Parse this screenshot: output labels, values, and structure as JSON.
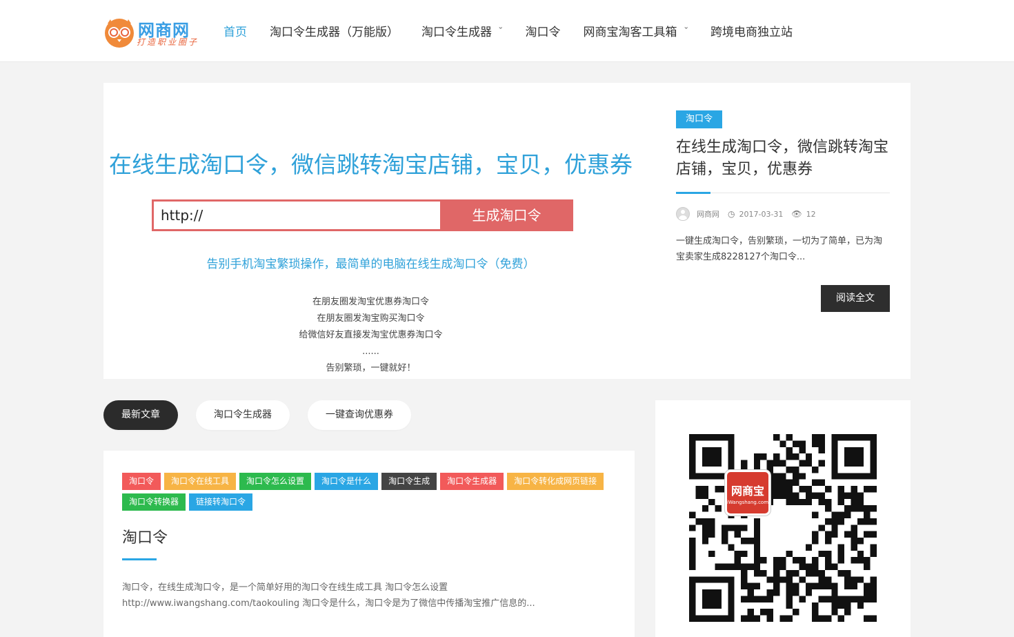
{
  "colors": {
    "accent": "#2fa1d9",
    "generate_btn": "#e06767",
    "dark": "#2b2b2b"
  },
  "header": {
    "logo": {
      "name": "网商网",
      "slogan": "打造职业圈子",
      "icon": "owl-icon"
    },
    "nav": [
      {
        "label": "首页",
        "active": true,
        "dropdown": false
      },
      {
        "label": "淘口令生成器（万能版）",
        "active": false,
        "dropdown": false
      },
      {
        "label": "淘口令生成器",
        "active": false,
        "dropdown": true
      },
      {
        "label": "淘口令",
        "active": false,
        "dropdown": false
      },
      {
        "label": "网商宝淘客工具箱",
        "active": false,
        "dropdown": true
      },
      {
        "label": "跨境电商独立站",
        "active": false,
        "dropdown": false
      }
    ]
  },
  "hero": {
    "title": "在线生成淘口令，微信跳转淘宝店铺，宝贝，优惠券",
    "input_value": "http://",
    "generate_label": "生成淘口令",
    "subtitle": "告别手机淘宝繁琐操作，最简单的电脑在线生成淘口令（免费）",
    "lines": [
      "在朋友圈发淘宝优惠券淘口令",
      "在朋友圈发淘宝购买淘口令",
      "给微信好友直接发淘宝优惠券淘口令",
      "......",
      "告别繁琐，一键就好！"
    ]
  },
  "featured": {
    "tag": "淘口令",
    "title": "在线生成淘口令，微信跳转淘宝店铺，宝贝，优惠券",
    "author": "网商网",
    "date": "2017-03-31",
    "views": "12",
    "excerpt": "一键生成淘口令，告别繁琐，一切为了简单，已为淘宝卖家生成8228127个淘口令...",
    "read_label": "阅读全文"
  },
  "tabs": [
    {
      "label": "最新文章",
      "active": true
    },
    {
      "label": "淘口令生成器",
      "active": false
    },
    {
      "label": "一键查询优惠券",
      "active": false
    }
  ],
  "article": {
    "tags": [
      {
        "label": "淘口令",
        "color": "#f25a5a"
      },
      {
        "label": "淘口令在线工具",
        "color": "#f7b445"
      },
      {
        "label": "淘口令怎么设置",
        "color": "#2dba4e"
      },
      {
        "label": "淘口令是什么",
        "color": "#2aa6e4"
      },
      {
        "label": "淘口令生成",
        "color": "#444444"
      },
      {
        "label": "淘口令生成器",
        "color": "#f25a5a"
      },
      {
        "label": "淘口令转化成网页链接",
        "color": "#f7b445"
      },
      {
        "label": "淘口令转换器",
        "color": "#2dba4e"
      },
      {
        "label": "链接转淘口令",
        "color": "#2aa6e4"
      }
    ],
    "title": "淘口令",
    "excerpt": "淘口令，在线生成淘口令，是一个简单好用的淘口令在线生成工具 淘口令怎么设置 http://www.iwangshang.com/taokouling 淘口令是什么，淘口令是为了微信中传播淘宝推广信息的..."
  },
  "sidebar": {
    "qr_badge_name": "网商宝",
    "qr_badge_url": "iWangshang.com"
  }
}
